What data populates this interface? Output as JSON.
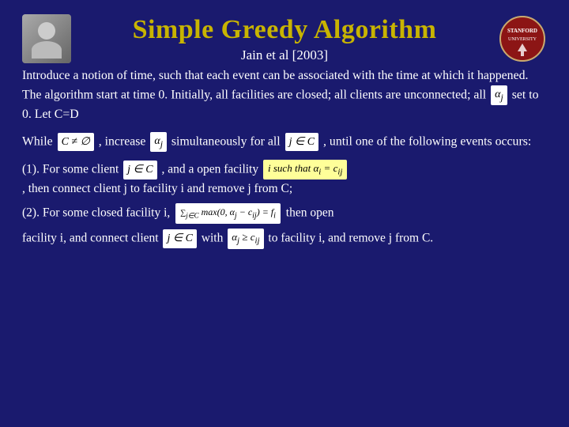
{
  "slide": {
    "title": "Simple Greedy Algorithm",
    "subtitle": "Jain et al [2003]",
    "intro": "Introduce a notion of time, such that each event can be associated with the time at which it happened. The algorithm start at time 0. Initially, all facilities are closed; all clients are unconnected;  all",
    "intro_alpha": "αj",
    "intro_end": "set to 0. Let C=D",
    "while_prefix": "While",
    "while_box": "C ≠ ∅",
    "while_middle": ", increase",
    "while_alpha": "αj",
    "while_end": "simultaneously for all",
    "while_jC": "j ∈ C",
    "while_until": ",  until one of the following events occurs:",
    "event1_prefix": "(1). For some client",
    "event1_jC": "j ∈ C",
    "event1_mid": ",  and a open facility",
    "event1_highlight": "i  such that αi = cij",
    "event1_end": ", then connect client j  to facility i and remove j from C;",
    "event2_prefix": "(2). For some closed facility i,",
    "event2_sum": "∑ max(0, αj − cij) = fi",
    "event2_sum_sub": "j∈C",
    "event2_end": "then open",
    "event3_prefix": "facility i, and connect client",
    "event3_jC": "j ∈ C",
    "event3_mid": "with",
    "event3_alpha": "αj ≥ cij",
    "event3_end": "to facility i, and remove j from C."
  }
}
